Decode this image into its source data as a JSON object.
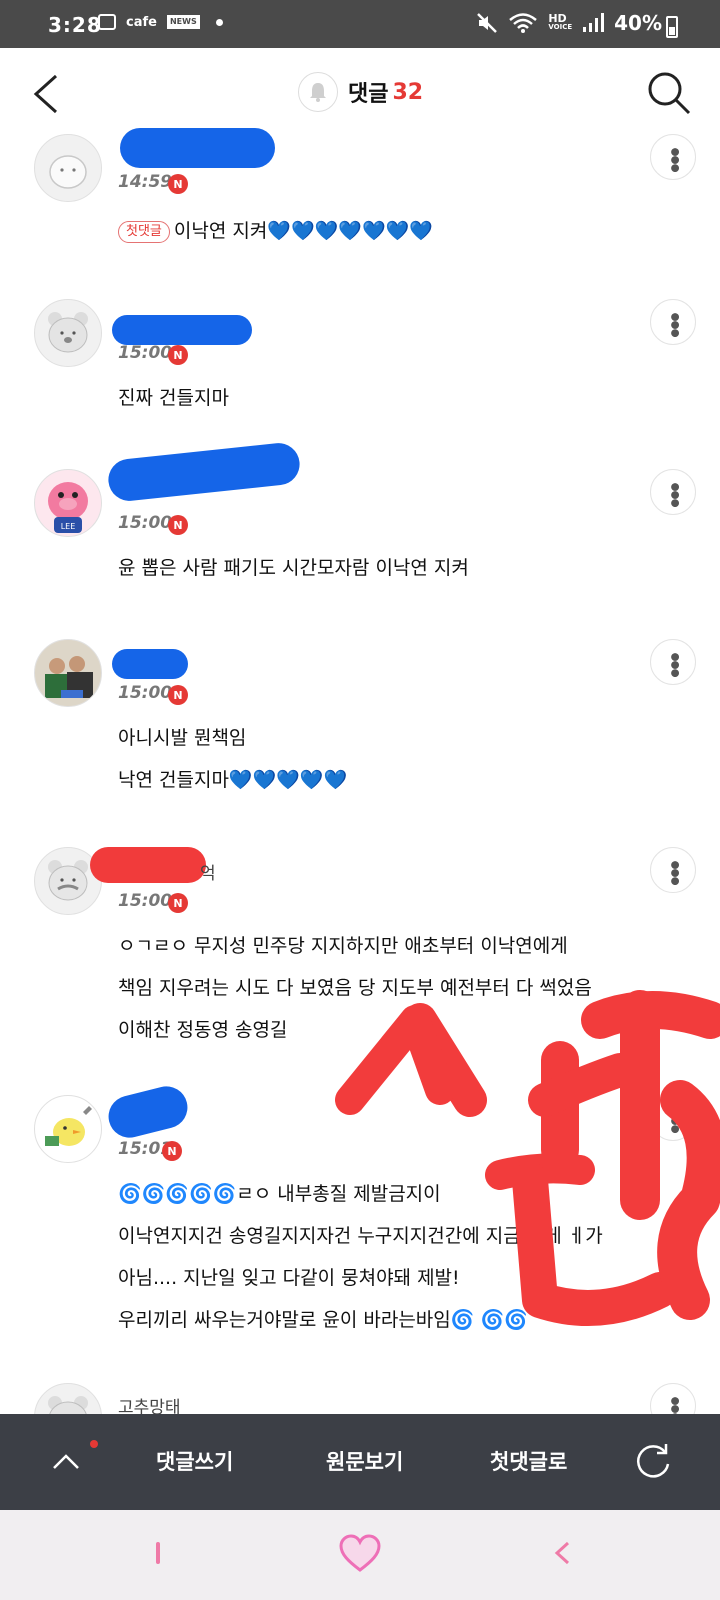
{
  "status_bar": {
    "time": "3:28",
    "cafe_label": "cafe",
    "news_label": "NEWS",
    "hd_label": "HD",
    "voice_label": "VOICE",
    "battery": "40%"
  },
  "header": {
    "title": "댓글",
    "count": "32"
  },
  "comments": [
    {
      "time": "14:59",
      "badge": "N",
      "first_badge": "첫댓글",
      "lines": [
        "이낙연 지켜💙💙💙💙💙💙💙"
      ]
    },
    {
      "time": "15:00",
      "badge": "N",
      "lines": [
        "진짜 건들지마"
      ]
    },
    {
      "time": "15:00",
      "badge": "N",
      "avatar_text": "LEE",
      "lines": [
        "윤 뽑은 사람 패기도 시간모자람 이낙연 지켜"
      ]
    },
    {
      "time": "15:00",
      "badge": "N",
      "lines": [
        "아니시발 뭔책임",
        "낙연 건들지마💙💙💙💙💙"
      ]
    },
    {
      "nick_suffix": "억",
      "time": "15:00",
      "badge": "N",
      "lines": [
        "ㅇㄱㄹㅇ 무지성 민주당 지지하지만 애초부터 이낙연에게",
        "책임 지우려는 시도 다 보였음 당 지도부 예전부터 다 썩었음",
        "이해찬 정동영 송영길"
      ]
    },
    {
      "time": "15:01",
      "badge": "N",
      "lines": [
        "🌀🌀🌀🌀🌀ㄹㅇ 내부총질 제발금지이                   ",
        "이낙연지지건 송영길지지자건 누구지지건간에 지금 그게       ㅔ가",
        "아님.... 지난일 잊고 다같이 뭉쳐야돼 제발!",
        "우리끼리 싸우는거야말로 윤이 바라는바임🌀         🌀🌀"
      ]
    },
    {
      "nick": "고추망태"
    }
  ],
  "bottom_bar": {
    "write": "댓글쓰기",
    "original": "원문보기",
    "first": "첫댓글로"
  },
  "colors": {
    "accent_red": "#e53935",
    "redaction_blue": "#1565e8",
    "redaction_red": "#f13b3b",
    "scribble_red": "#f23c3c",
    "bottom_bar": "#3c3f46"
  }
}
